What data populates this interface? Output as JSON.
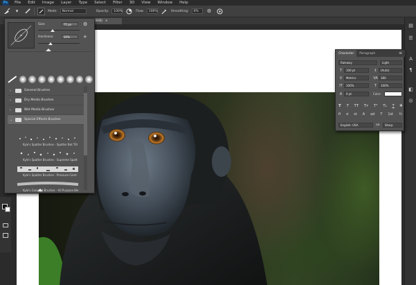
{
  "menu": {
    "logo": "Ps",
    "items": [
      "File",
      "Edit",
      "Image",
      "Layer",
      "Type",
      "Select",
      "Filter",
      "3D",
      "View",
      "Window",
      "Help"
    ]
  },
  "options": {
    "mode_label": "Mode:",
    "mode_value": "Normal",
    "opacity_label": "Opacity:",
    "opacity_value": "100%",
    "flow_label": "Flow:",
    "flow_value": "100%",
    "smoothing_label": "Smoothing:",
    "smoothing_value": "0%"
  },
  "document": {
    "tab_label": "RGB/8)",
    "close_glyph": "×"
  },
  "brush_panel": {
    "size_label": "Size:",
    "size_value": "75 px",
    "hardness_label": "Hardness:",
    "hardness_value": "30%",
    "size_level": 0.35,
    "hardness_level": 0.3,
    "folders": [
      {
        "name": "General Brushes",
        "active": false
      },
      {
        "name": "Dry Media Brushes",
        "active": false
      },
      {
        "name": "Wet Media Brushes",
        "active": false
      },
      {
        "name": "Special Effects Brushes",
        "active": true
      }
    ],
    "presets": [
      "Kyle's Spatter Brushes - Spatter Bot Tilt",
      "Kyle's Spatter Brushes - Supreme Spatt",
      "Kyle's Spatter Brushes - Pressure Contr",
      "Kyle's Concept Brushes - All Purpose Ble"
    ]
  },
  "character_panel": {
    "tabs": [
      "Character",
      "Paragraph"
    ],
    "font_family": "Raleway",
    "font_style": "Light",
    "font_size": "100 pt",
    "leading": "(Auto)",
    "kerning": "Metrics",
    "tracking": "380",
    "vertical_scale": "100%",
    "horizontal_scale": "100%",
    "baseline_shift": "0 pt",
    "color_label": "Color:",
    "style_buttons": [
      "T",
      "T",
      "TT",
      "Tт",
      "T¹",
      "T₁",
      "T",
      "T"
    ],
    "opentype_buttons": [
      "fi",
      "ơ",
      "st",
      "A",
      "ad",
      "T",
      "1st",
      "½"
    ],
    "language": "English: USA",
    "antialias_icon": "aa",
    "antialias": "Sharp"
  },
  "colors": {
    "photoshop_blue": "#31a8ff",
    "panel_bg": "#535353",
    "canvas_bg": "#ffffff"
  }
}
